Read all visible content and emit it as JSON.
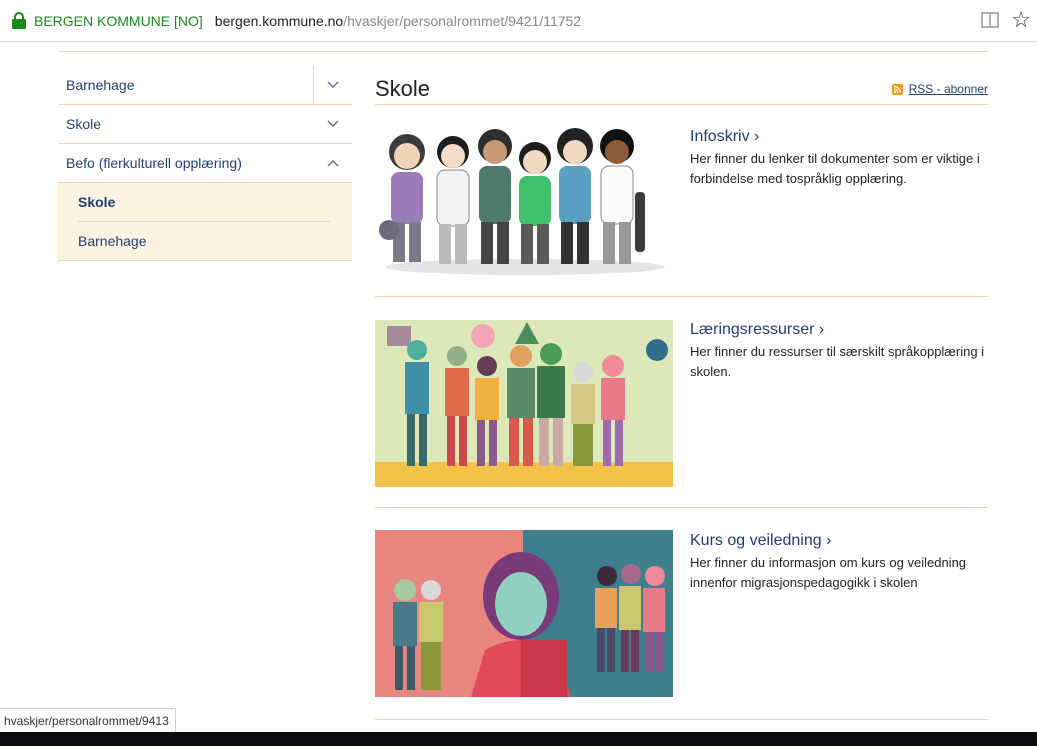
{
  "browser": {
    "site_identity": "BERGEN KOMMUNE [NO]",
    "url_host": "bergen.kommune.no",
    "url_path": "/hvaskjer/personalrommet/9421/11752",
    "status_url": "hvaskjer/personalrommet/9413"
  },
  "sidebar": {
    "items": [
      {
        "label": "Barnehage"
      },
      {
        "label": "Skole"
      },
      {
        "label": "Befo (flerkulturell opplæring)"
      }
    ],
    "subitems": [
      {
        "label": "Skole"
      },
      {
        "label": "Barnehage"
      }
    ]
  },
  "main": {
    "title": "Skole",
    "rss_label": "RSS - abonner",
    "cards": [
      {
        "title": "Infoskriv ›",
        "desc": "Her finner du lenker til dokumenter som er viktige i forbindelse med tospråklig opplæring."
      },
      {
        "title": "Læringsressurser ›",
        "desc": "Her finner du ressurser til særskilt språkopplæring i skolen."
      },
      {
        "title": "Kurs og veiledning ›",
        "desc": "Her finner du informasjon om kurs og veiledning innenfor migrasjonspedagogikk i skolen"
      }
    ]
  },
  "colors": {
    "link": "#1f3f73",
    "secure": "#1a8a1a",
    "divider": "#e6d6b6",
    "submenu_bg": "#faf3e2",
    "rss": "#f39a1e"
  }
}
